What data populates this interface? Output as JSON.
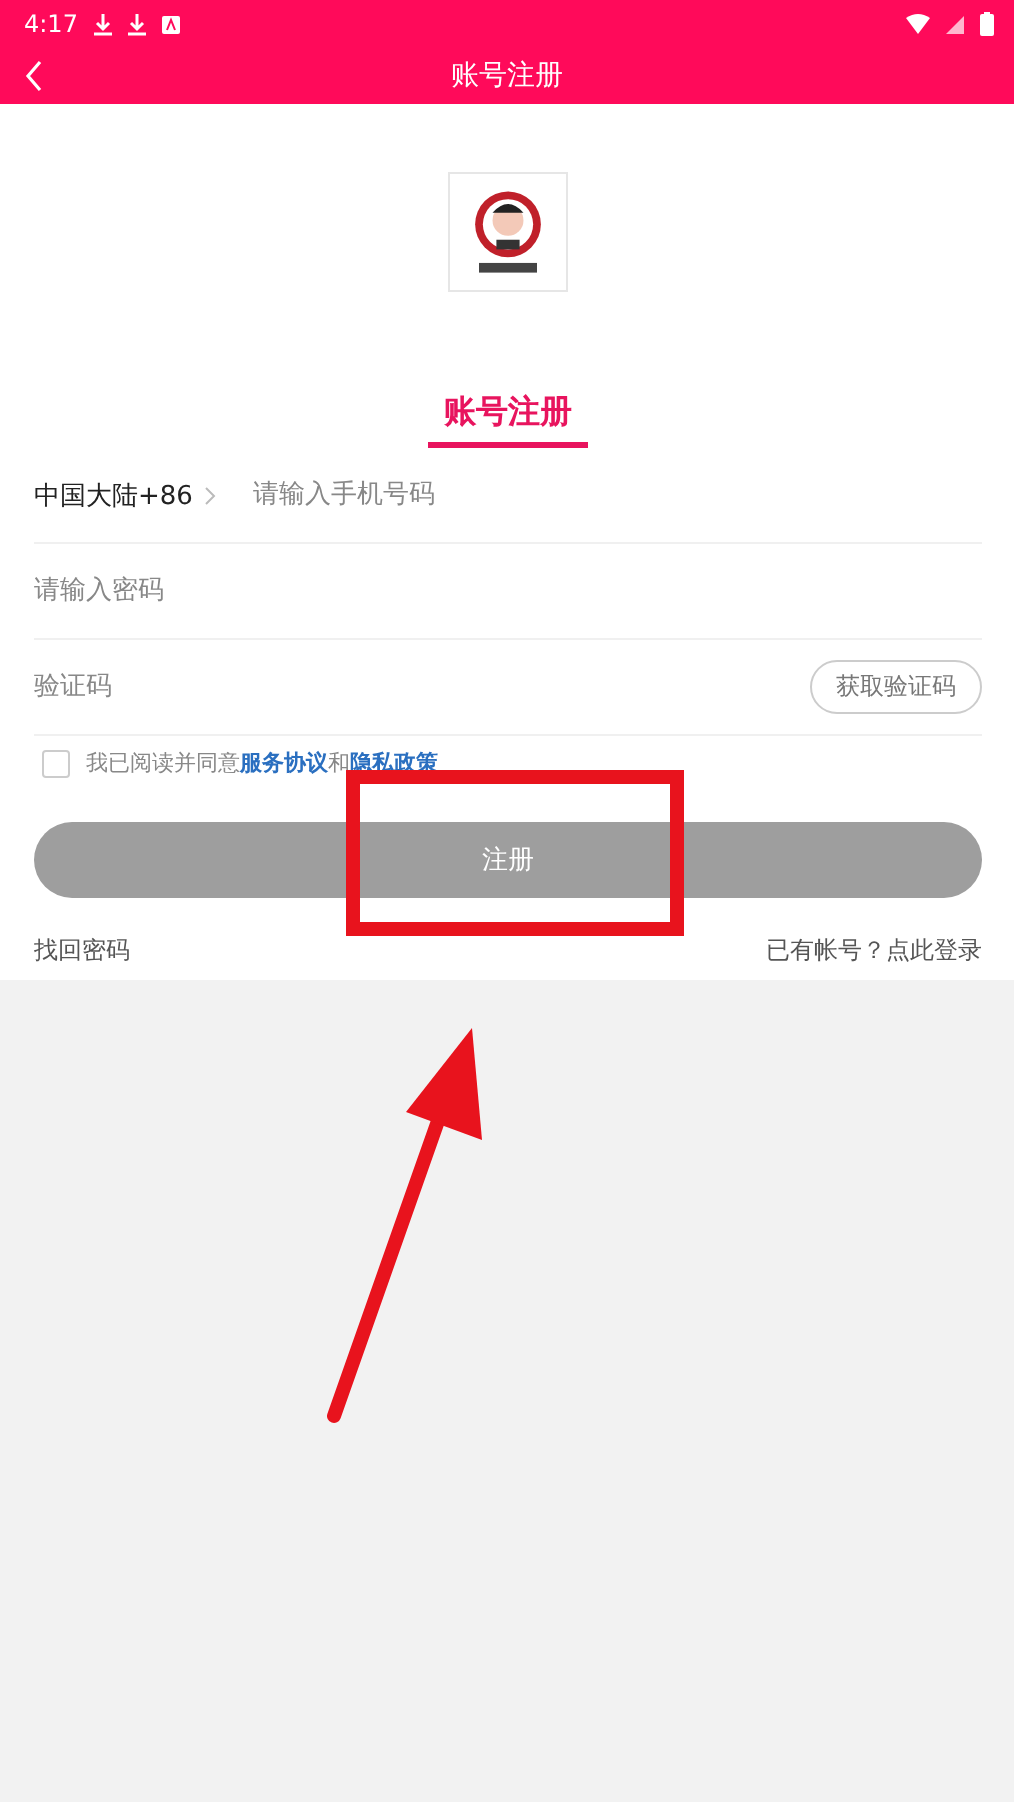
{
  "status_bar": {
    "time": "4:17"
  },
  "toolbar": {
    "title": "账号注册"
  },
  "tabs": [
    {
      "label": "账号注册",
      "selected": true
    }
  ],
  "form": {
    "region": "中国大陆+86",
    "phone": {
      "placeholder": "请输入手机号码"
    },
    "password": {
      "placeholder": "请输入密码"
    },
    "code": {
      "placeholder": "验证码"
    },
    "get_code_button": "获取验证码"
  },
  "agreement": {
    "checked": false,
    "text": "我已阅读并同意",
    "link1": "服务协议",
    "joiner": "和",
    "link2": "隐私政策"
  },
  "register_button": {
    "label": "注册",
    "disabled": true
  },
  "links": {
    "left": "找回密码",
    "right": "已有帐号？点此登录"
  }
}
